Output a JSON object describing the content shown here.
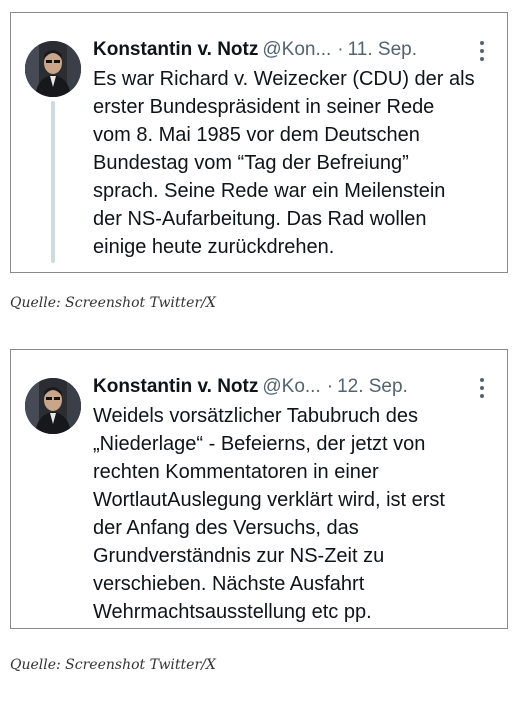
{
  "tweets": [
    {
      "name": "Konstantin v. Notz",
      "handle": "@Kon...",
      "separator": "·",
      "date": "11. Sep.",
      "more_icon": "more-vertical-icon",
      "lines": [
        "Es war Richard v. Weizecker (CDU) der als",
        "erster Bundespräsident in seiner Rede",
        "vom 8. Mai 1985 vor dem Deutschen",
        "Bundestag vom “Tag der Befreiung”",
        "sprach. Seine Rede war ein Meilenstein",
        "der NS-Aufarbeitung. Das Rad wollen",
        "einige heute zurückdrehen."
      ],
      "caption": "Quelle: Screenshot Twitter/X"
    },
    {
      "name": "Konstantin v. Notz",
      "handle": "@Ko...",
      "separator": "·",
      "date": "12. Sep.",
      "more_icon": "more-vertical-icon",
      "lines": [
        "Weidels vorsätzlicher Tabubruch des",
        "„Niederlage“ - Befeierns, der jetzt von",
        "rechten Kommentatoren in einer",
        "WortlautAuslegung verklärt wird, ist erst",
        "der Anfang des Versuchs, das",
        "Grundverständnis zur NS-Zeit zu",
        "verschieben. Nächste Ausfahrt",
        "Wehrmachtsausstellung etc pp."
      ],
      "caption": "Quelle: Screenshot Twitter/X"
    }
  ],
  "colors": {
    "text": "#0f1419",
    "secondary": "#536471",
    "thread_line": "#cfd9de",
    "card_border": "#8a8a8a"
  }
}
